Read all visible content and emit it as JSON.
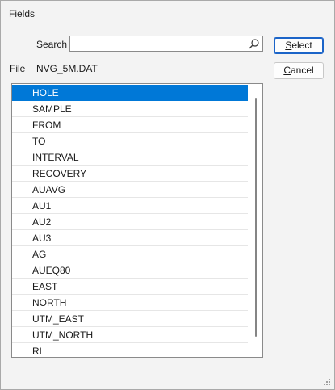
{
  "window": {
    "title": "Fields"
  },
  "search": {
    "label": "Search",
    "value": "",
    "placeholder": "",
    "icon": "search-icon"
  },
  "file": {
    "label": "File",
    "value": "NVG_5M.DAT"
  },
  "buttons": {
    "select": {
      "label_underlined": "S",
      "label_rest": "elect"
    },
    "cancel": {
      "label_underlined": "C",
      "label_rest": "ancel"
    }
  },
  "fields": {
    "selected_index": 0,
    "items": [
      "HOLE",
      "SAMPLE",
      "FROM",
      "TO",
      "INTERVAL",
      "RECOVERY",
      "AUAVG",
      "AU1",
      "AU2",
      "AU3",
      "AG",
      "AUEQ80",
      "EAST",
      "NORTH",
      "UTM_EAST",
      "UTM_NORTH",
      "RL"
    ]
  },
  "colors": {
    "selection": "#0078d7",
    "default_button_border": "#1b64c8",
    "dialog_background": "#f3f3f3"
  }
}
